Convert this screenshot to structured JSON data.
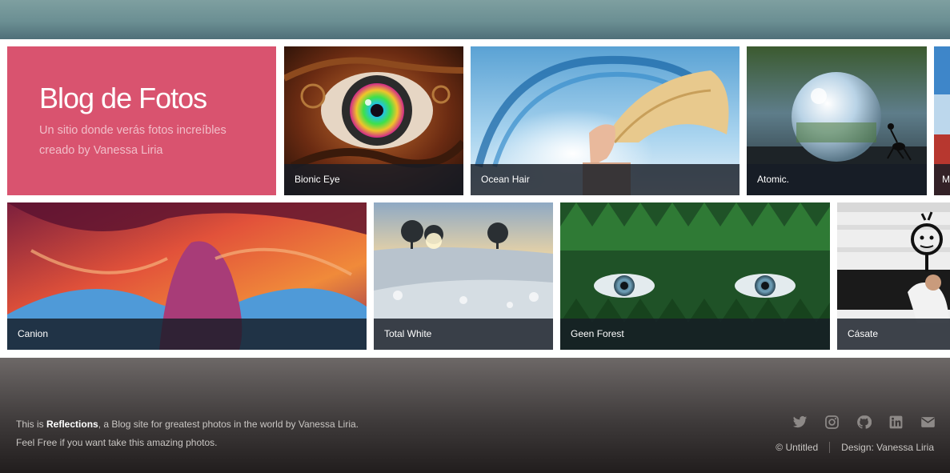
{
  "intro": {
    "title": "Blog de Fotos",
    "subtitle_line1": "Un sitio donde verás fotos increíbles",
    "subtitle_line2": "creado by Vanessa Liria"
  },
  "gallery": {
    "tiles": [
      {
        "caption": "Bionic Eye"
      },
      {
        "caption": "Ocean Hair"
      },
      {
        "caption": "Atomic."
      },
      {
        "caption": "M"
      },
      {
        "caption": "Canion"
      },
      {
        "caption": "Total White"
      },
      {
        "caption": "Geen Forest"
      },
      {
        "caption": "Cásate"
      }
    ]
  },
  "footer": {
    "text_prefix": "This is ",
    "brand": "Reflections",
    "text_suffix": ", a Blog site for greatest photos in the world by Vanessa Liria.",
    "line2": "Feel Free if you want take this amazing photos.",
    "copyright": "© Untitled",
    "design_credit": "Design: Vanessa Liria",
    "social_icons": [
      "twitter-icon",
      "instagram-icon",
      "github-icon",
      "linkedin-icon",
      "envelope-icon"
    ]
  },
  "colors": {
    "intro_bg": "#d9536f",
    "caption_bg": "#161c26",
    "footer_text": "#c9c6c3"
  }
}
